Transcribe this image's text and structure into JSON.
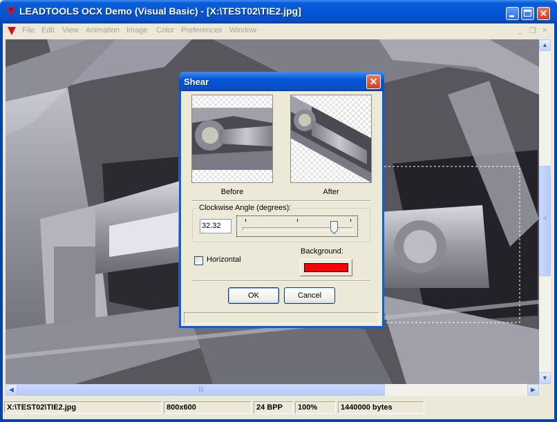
{
  "window": {
    "title": "LEADTOOLS OCX Demo (Visual Basic) - [X:\\TEST02\\TIE2.jpg]",
    "controls": {
      "minimize": "_",
      "maximize": "□",
      "close": "✕"
    }
  },
  "menu": {
    "items": [
      "File",
      "Edit",
      "View",
      "Animation",
      "Image",
      "Color",
      "Preferences",
      "Window"
    ],
    "mdi": {
      "minimize": "_",
      "restore": "❐",
      "close": "×"
    }
  },
  "statusbar": {
    "path": "X:\\TEST02\\TIE2.jpg",
    "dimensions": "800x600",
    "bpp": "24 BPP",
    "zoom": "100%",
    "size": "1440000 bytes"
  },
  "scroll": {
    "up": "▲",
    "down": "▼",
    "left": "◀",
    "right": "▶",
    "grip": "|||",
    "vgrip": "≡"
  },
  "dialog": {
    "title": "Shear",
    "close": "✕",
    "before_label": "Before",
    "after_label": "After",
    "angle_group_label": "Clockwise Angle (degrees):",
    "angle_value": "32.32",
    "horizontal_label": "Horizontal",
    "horizontal_checked": false,
    "background_label": "Background:",
    "background_color": "#ff0000",
    "ok_label": "OK",
    "cancel_label": "Cancel"
  },
  "colors": {
    "titlebar": "#0356d6",
    "dialog_face": "#ece9d8",
    "canvas": "#5a5a60"
  }
}
